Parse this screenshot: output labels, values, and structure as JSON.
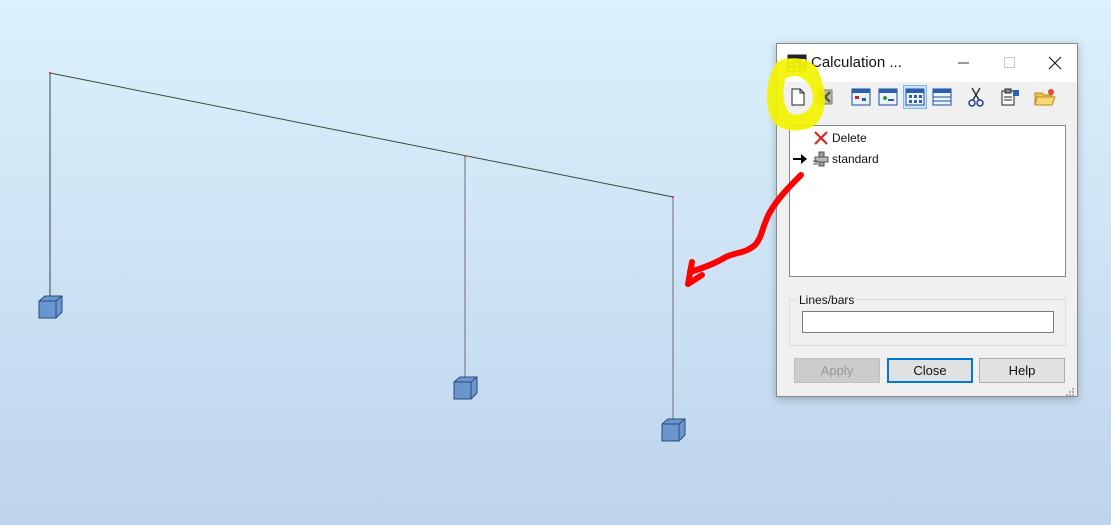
{
  "window": {
    "title": "Calculation ...",
    "icon": "table-icon",
    "controls": [
      "minimize-icon",
      "maximize-icon",
      "close-icon"
    ]
  },
  "toolbar": {
    "items": [
      {
        "name": "new-icon"
      },
      {
        "name": "delete-icon"
      },
      {
        "name": "view-icon-1"
      },
      {
        "name": "view-icon-2"
      },
      {
        "name": "view-icon-3",
        "active": true
      },
      {
        "name": "table-view-icon"
      },
      {
        "name": "cut-icon"
      },
      {
        "name": "properties-icon"
      },
      {
        "name": "open-folder-icon"
      }
    ]
  },
  "tree": {
    "items": [
      {
        "label": "Delete",
        "icon": "red-x-icon",
        "current": false
      },
      {
        "label": "standard",
        "icon": "calculation-type-icon",
        "current": true
      }
    ]
  },
  "lines_bars": {
    "label": "Lines/bars",
    "value": ""
  },
  "buttons": {
    "apply": "Apply",
    "close": "Close",
    "help": "Help"
  },
  "annotations": {
    "highlight_color": "#f3f300",
    "arrow_color": "#ff0000"
  },
  "colors": {
    "accent": "#0078d7",
    "support_fill": "#6a95cf"
  }
}
